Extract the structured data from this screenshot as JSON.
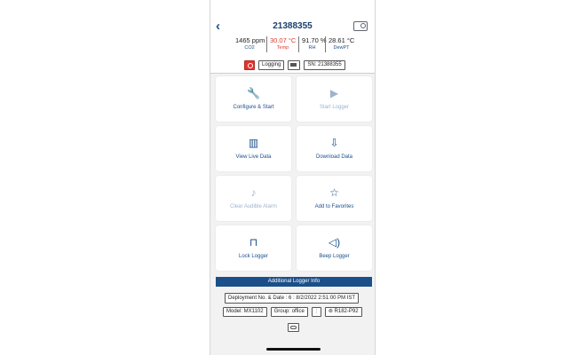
{
  "header": {
    "title": "21388355"
  },
  "readings": [
    {
      "value": "1465 ppm",
      "label": "CO2",
      "warn": false
    },
    {
      "value": "30.07 °C",
      "label": "Temp",
      "warn": true
    },
    {
      "value": "91.70 %",
      "label": "RH",
      "warn": false
    },
    {
      "value": "28.61 °C",
      "label": "DewPT",
      "warn": false
    }
  ],
  "status": {
    "state": "Logging",
    "serial": "SN: 21388355"
  },
  "tiles": [
    {
      "label": "Configure & Start",
      "icon": "wrench-icon",
      "glyph": "🔧",
      "enabled": true
    },
    {
      "label": "Start Logger",
      "icon": "play-icon",
      "glyph": "▶",
      "enabled": false
    },
    {
      "label": "View Live Data",
      "icon": "bar-chart-icon",
      "glyph": "▥",
      "enabled": true
    },
    {
      "label": "Download Data",
      "icon": "download-icon",
      "glyph": "⇩",
      "enabled": true
    },
    {
      "label": "Clear Audible Alarm",
      "icon": "bell-icon",
      "glyph": "♪",
      "enabled": false
    },
    {
      "label": "Add to Favorites",
      "icon": "star-icon",
      "glyph": "☆",
      "enabled": true
    },
    {
      "label": "Lock Logger",
      "icon": "unlock-icon",
      "glyph": "⊓",
      "enabled": true
    },
    {
      "label": "Beep Logger",
      "icon": "speaker-icon",
      "glyph": "◁)",
      "enabled": true
    }
  ],
  "info": {
    "section_title": "Additional Logger Info",
    "deployment": "Deployment No. & Date : 6 : 8/2/2022 2:51:00 PM IST",
    "model": "Model: MX1102",
    "group": "Group: office",
    "signal": "R182-P92"
  },
  "colors": {
    "accent": "#1b4f8a",
    "warn": "#e03a2f",
    "disabled": "#9fb4cc"
  }
}
